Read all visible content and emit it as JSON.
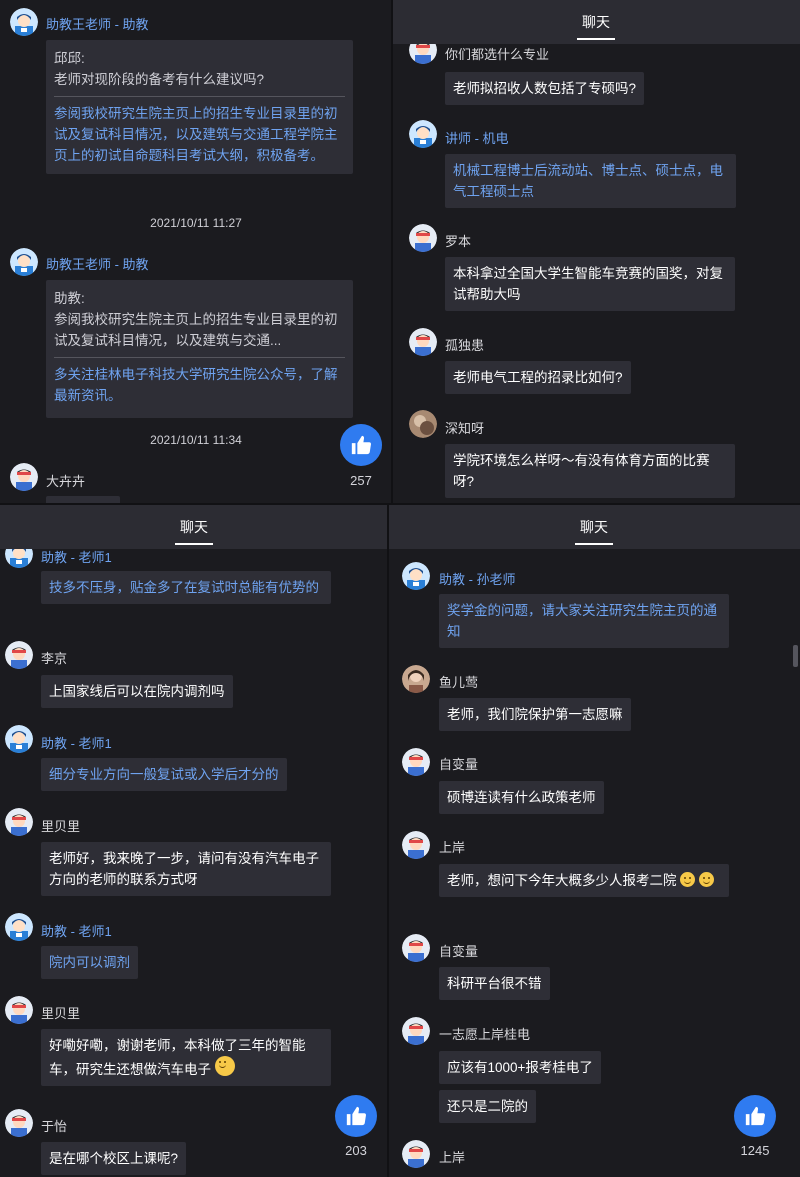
{
  "header_title": "聊天",
  "panel1": {
    "m1": {
      "name": "助教王老师 - 助教",
      "q_head": "邱邱:",
      "q_body": "老师对现阶段的备考有什么建议吗?",
      "reply": "参阅我校研究生院主页上的招生专业目录里的初试及复试科目情况，以及建筑与交通工程学院主页上的初试自命题科目考试大纲，积极备考。"
    },
    "t1": "2021/10/11 11:27",
    "m2": {
      "name": "助教王老师 - 助教",
      "q_head": "助教:",
      "q_body": "参阅我校研究生院主页上的招生专业目录里的初试及复试科目情况，以及建筑与交通...",
      "reply": "多关注桂林电子科技大学研究生院公众号，了解最新资讯。"
    },
    "t2": "2021/10/11 11:34",
    "m3": {
      "name": "大卉卉"
    },
    "likes": "257"
  },
  "panel2": {
    "m0": {
      "text": "你们都选什么专业"
    },
    "m1": {
      "text": "老师拟招收人数包括了专硕吗?"
    },
    "m2": {
      "name": "讲师 - 机电",
      "text": "机械工程博士后流动站、博士点、硕士点，电气工程硕士点"
    },
    "m3": {
      "name": "罗本",
      "text": "本科拿过全国大学生智能车竞赛的国奖，对复试帮助大吗"
    },
    "m4": {
      "name": "孤独患",
      "text": "老师电气工程的招录比如何?"
    },
    "m5": {
      "name": "深知呀",
      "text": "学院环境怎么样呀～有没有体育方面的比赛呀?"
    }
  },
  "panel3": {
    "m0": {
      "name": "助教 - 老师1",
      "text": "技多不压身，贴金多了在复试时总能有优势的"
    },
    "m1": {
      "name": "李京",
      "text": "上国家线后可以在院内调剂吗"
    },
    "m2": {
      "name": "助教 - 老师1",
      "text": "细分专业方向一般复试或入学后才分的"
    },
    "m3": {
      "name": "里贝里",
      "text": "老师好，我来晚了一步，请问有没有汽车电子方向的老师的联系方式呀"
    },
    "m4": {
      "name": "助教 - 老师1",
      "text": "院内可以调剂"
    },
    "m5": {
      "name": "里贝里",
      "text": "好嘞好嘞，谢谢老师，本科做了三年的智能车，研究生还想做汽车电子"
    },
    "m6": {
      "name": "于怡",
      "text": "是在哪个校区上课呢?"
    },
    "likes": "203"
  },
  "panel4": {
    "m0": {
      "name": "助教 - 孙老师",
      "text": "奖学金的问题，请大家关注研究生院主页的通知"
    },
    "m1": {
      "name": "鱼儿莺",
      "text": "老师，我们院保护第一志愿嘛"
    },
    "m2": {
      "name": "自变量",
      "text": "硕博连读有什么政策老师"
    },
    "m3": {
      "name": "上岸",
      "text": "老师，想问下今年大概多少人报考二院"
    },
    "m4": {
      "name": "自变量",
      "text": "科研平台很不错"
    },
    "m5": {
      "name": "一志愿上岸桂电",
      "text": "应该有1000+报考桂电了",
      "text2": "还只是二院的"
    },
    "m6": {
      "name": "上岸"
    },
    "likes": "1245"
  },
  "colors": {
    "background": "#1b1b1f",
    "header": "#2c2c33",
    "bubble": "#2e2e36",
    "assistant_text": "#6fa3f0",
    "like_button": "#2f7bf0"
  },
  "icons": {
    "like": "thumbs-up-icon",
    "user_avatar": "user-avatar-icon",
    "assistant_avatar": "assistant-avatar-icon",
    "emoji": "smiley-emoji-icon"
  }
}
